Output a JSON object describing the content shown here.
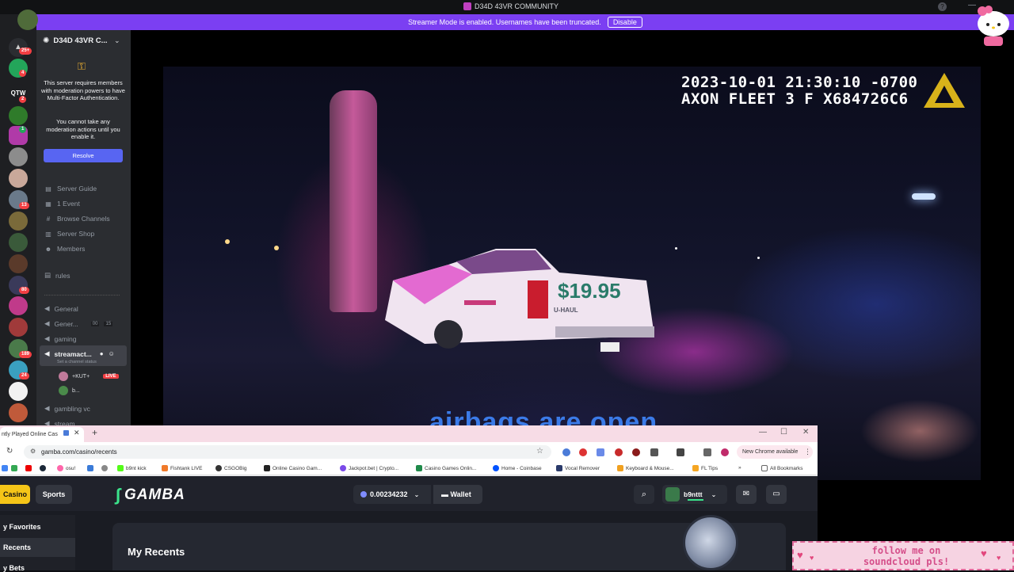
{
  "discord": {
    "window_title": "D34D 43VR COMMUNITY",
    "streamer_banner": {
      "text": "Streamer Mode is enabled. Usernames have been truncated.",
      "button": "Disable"
    },
    "rail_badges": [
      "25+",
      "4",
      "2",
      "1",
      "13",
      "80",
      "189",
      "24"
    ],
    "server_name": "D34D 43VR C...",
    "mfa_notice": "This server requires members with moderation powers to have Multi-Factor Authentication.",
    "mfa_notice2": "You cannot take any moderation actions until you enable it.",
    "resolve_button": "Resolve",
    "nav": [
      "Server Guide",
      "1 Event",
      "Browse Channels",
      "Server Shop",
      "Members"
    ],
    "channels": {
      "rules": "rules",
      "general": "General",
      "general2": "Gener...",
      "general2_count_a": "00",
      "general2_count_b": "15",
      "gaming": "gaming",
      "streamact": "streamact...",
      "streamact_status": "Set a channel status",
      "vc_user1": "+KUT+",
      "vc_user1_badge": "LIVE",
      "vc_user2": "b...",
      "gambling": "gambling vc",
      "stream": "stream"
    }
  },
  "video": {
    "timestamp_line1": "2023-10-01 21:30:10 -0700",
    "timestamp_line2": "AXON FLEET 3 F X684726C6",
    "caption": "airbags are open",
    "truck_price": "$19.95",
    "plate": "U-HAUL"
  },
  "chrome": {
    "tab_title": "ntly Played Online Cas",
    "url": "gamba.com/casino/recents",
    "new_chrome": "New Chrome available",
    "bookmarks": [
      "b9nt kick",
      "Fishtank LIVE",
      "CSGOBig",
      "Online Casino Gam...",
      "Jackpot.bet | Crypto...",
      "Casino Games Onlin...",
      "Home - Coinbase",
      "Vocal Remover",
      "Keyboard & Mouse...",
      "FL Tips"
    ],
    "bookmark_cut": "osu!",
    "all_bookmarks": "All Bookmarks"
  },
  "gamba": {
    "casino": "Casino",
    "sports": "Sports",
    "logo": "GAMBA",
    "balance": "0.00234232",
    "wallet": "Wallet",
    "username": "b9nttt",
    "side": [
      "y Favorites",
      "Recents",
      "y Bets"
    ],
    "page_title": "My Recents"
  },
  "overlay": {
    "soundcloud_line1": "follow me on",
    "soundcloud_line2": "soundcloud pls!"
  },
  "colors": {
    "discord_blurple": "#5865f2",
    "streamer_banner": "#7b3ff2",
    "gamba_green": "#3be38b",
    "casino_yellow": "#f5c518",
    "live_red": "#f23f43"
  }
}
